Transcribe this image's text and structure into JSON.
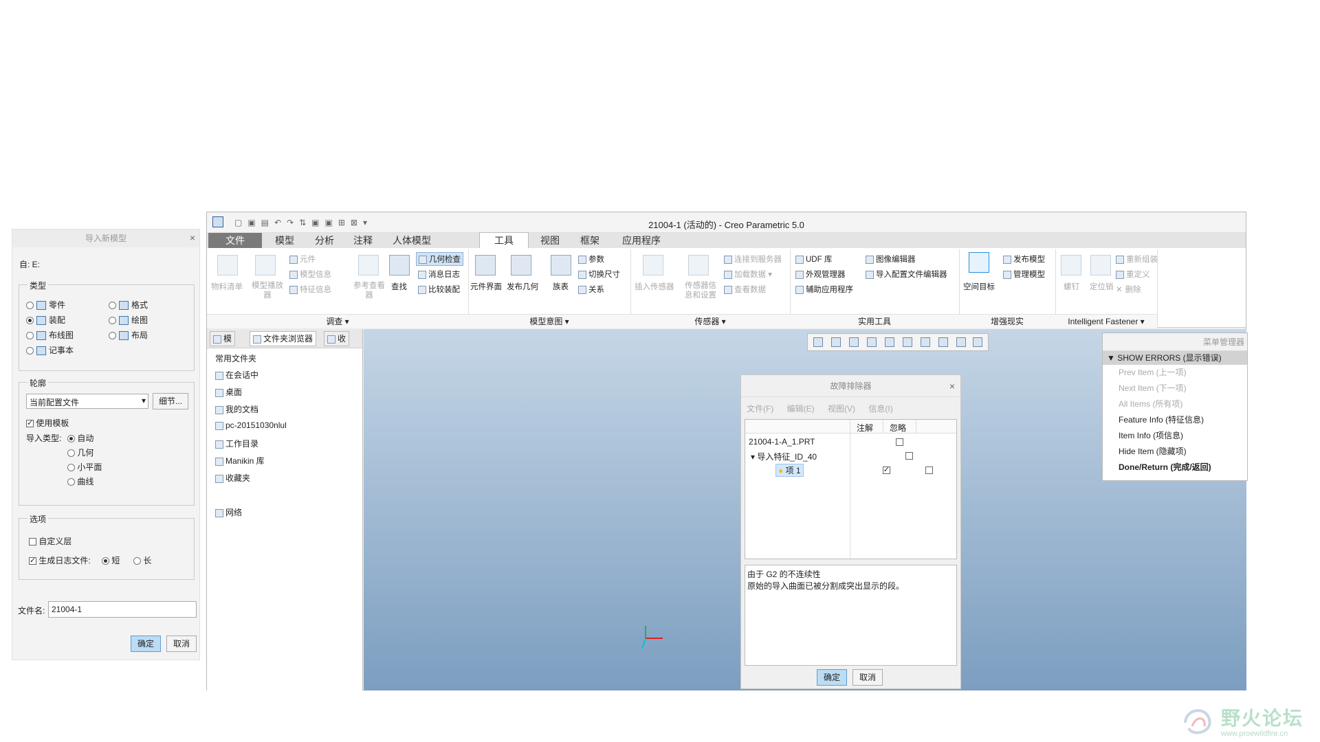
{
  "import_dialog": {
    "title": "导入新模型",
    "from_prefix": "自: E:",
    "type_label": "类型",
    "types": [
      "零件",
      "装配",
      "布线图",
      "记事本",
      "格式",
      "绘图",
      "布局"
    ],
    "profile_label": "轮廓",
    "profile_value": "当前配置文件",
    "details_button": "细节...",
    "use_template": "使用模板",
    "import_type_label": "导入类型:",
    "import_types": [
      "自动",
      "几何",
      "小平面",
      "曲线"
    ],
    "options_label": "选项",
    "custom_layer": "自定义层",
    "gen_log": "生成日志文件:",
    "log_short": "短",
    "log_long": "长",
    "filename_label": "文件名:",
    "filename_value": "21004-1",
    "ok": "确定",
    "cancel": "取消"
  },
  "window": {
    "title": "21004-1 (活动的) - Creo Parametric 5.0",
    "tabs": [
      "文件",
      "模型",
      "分析",
      "注释",
      "人体模型",
      "工具",
      "视图",
      "框架",
      "应用程序"
    ],
    "ribbon": {
      "items": [
        "物料清单",
        "模型播放器",
        "元件",
        "模型信息",
        "特征信息",
        "参考查看器",
        "查找",
        "几何检查",
        "消息日志",
        "比较装配",
        "元件界面",
        "发布几何",
        "族表",
        "参数",
        "切换尺寸",
        "关系",
        "插入传感器",
        "传感器信息和设置",
        "连接到服务器",
        "加载数据",
        "查看数据",
        "UDF 库",
        "外观管理器",
        "辅助应用程序",
        "图像编辑器",
        "导入配置文件编辑器",
        "空间目标",
        "发布模型",
        "管理模型",
        "螺钉",
        "定位销",
        "重新组装",
        "重定义",
        "删除"
      ],
      "groups": [
        "调查",
        "模型意图",
        "传感器",
        "实用工具",
        "增强现实",
        "Intelligent Fastener"
      ]
    },
    "left_tabs": [
      "模",
      "文件夹浏览器",
      "收"
    ],
    "folders": {
      "header": "常用文件夹",
      "items": [
        "在会话中",
        "桌面",
        "我的文档",
        "pc-20151030nlul",
        "工作目录",
        "Manikin 库",
        "收藏夹",
        "网络"
      ]
    }
  },
  "troubleshooter": {
    "title": "故障排除器",
    "menu": [
      "文件(F)",
      "编辑(E)",
      "视图(V)",
      "信息(I)"
    ],
    "cols": [
      "注解",
      "忽略"
    ],
    "rows": [
      "21004-1-A_1.PRT",
      "导入特征_ID_40",
      "项 1"
    ],
    "message": [
      "由于 G2 的不连续性",
      "原始的导入曲面已被分割成突出显示的段。"
    ],
    "ok": "确定",
    "cancel": "取消"
  },
  "menu_manager": {
    "title": "菜单管理器",
    "section": "SHOW ERRORS (显示错误)",
    "items": [
      "Prev Item (上一项)",
      "Next Item (下一项)",
      "All Items (所有项)",
      "Feature Info (特征信息)",
      "Item Info (项信息)",
      "Hide Item (隐藏项)",
      "Done/Return (完成/返回)"
    ]
  },
  "watermark": {
    "text": "野火论坛",
    "url": "www.proewildfire.cn"
  }
}
